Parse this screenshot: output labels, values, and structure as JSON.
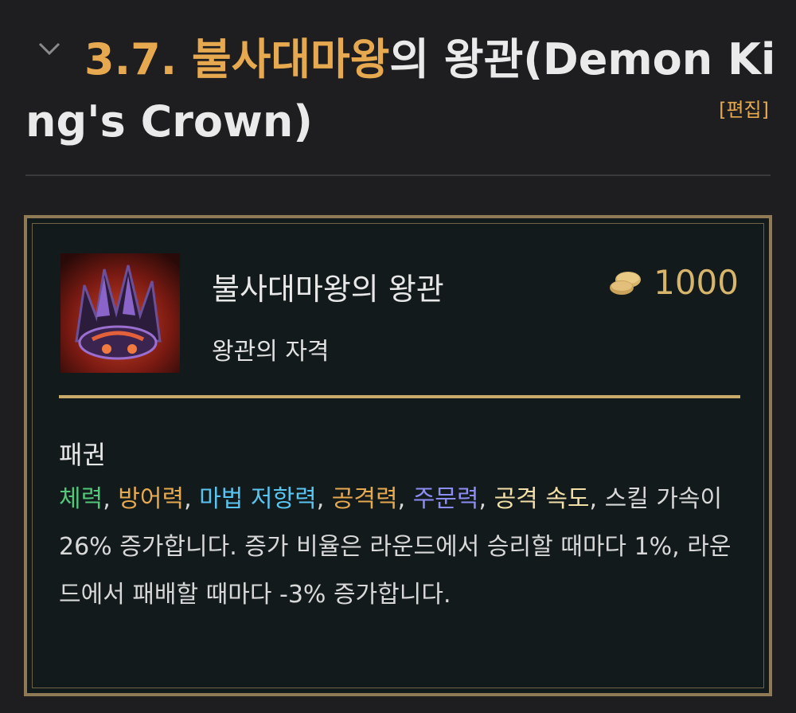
{
  "heading": {
    "number": "3.7.",
    "highlight": "불사대마왕",
    "rest": "의 왕관(Demon Ki",
    "line2": "ng's Crown)",
    "edit_label": "[편집]"
  },
  "item": {
    "name": "불사대마왕의 왕관",
    "subtitle": "왕관의 자격",
    "price": "1000",
    "icon": "demon-king-crown-icon"
  },
  "passive": {
    "title": "패권",
    "stats": [
      "체력",
      "방어력",
      "마법 저항력",
      "공격력",
      "주문력",
      "공격 속도"
    ],
    "sep": ", ",
    "text_after_stats": ", 스킬 가속이 26% 증가합니다. 증가 비율은 라운드에서 승리할 때마다 1%, 라운드에서 패배할 때마다 -3% 증가합니다."
  },
  "colors": {
    "accent": "#e7a94f",
    "hp": "#52c77a",
    "mr": "#58c4f0",
    "ap": "#8c8cf5",
    "attack_speed": "#f2e0a8",
    "card_border": "#8f7a55",
    "card_bg": "#131a1b"
  }
}
